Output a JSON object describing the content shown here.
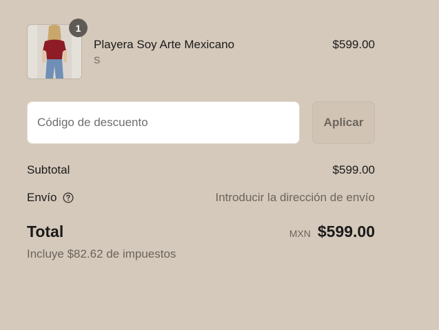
{
  "product": {
    "name": "Playera Soy Arte Mexicano",
    "variant": "S",
    "price": "$599.00",
    "quantity": "1",
    "image_icon": "t-shirt-model-photo"
  },
  "discount": {
    "placeholder": "Código de descuento",
    "value": "",
    "apply_label": "Aplicar"
  },
  "summary": {
    "subtotal_label": "Subtotal",
    "subtotal_value": "$599.00",
    "shipping_label": "Envío",
    "shipping_help_icon": "question-circle-icon",
    "shipping_value": "Introducir la dirección de envío",
    "total_label": "Total",
    "currency": "MXN",
    "total_value": "$599.00",
    "tax_note": "Incluye $82.62 de impuestos"
  },
  "colors": {
    "background": "#d5c9bb",
    "badge": "#5f5a55",
    "muted_text": "#6b645c"
  }
}
